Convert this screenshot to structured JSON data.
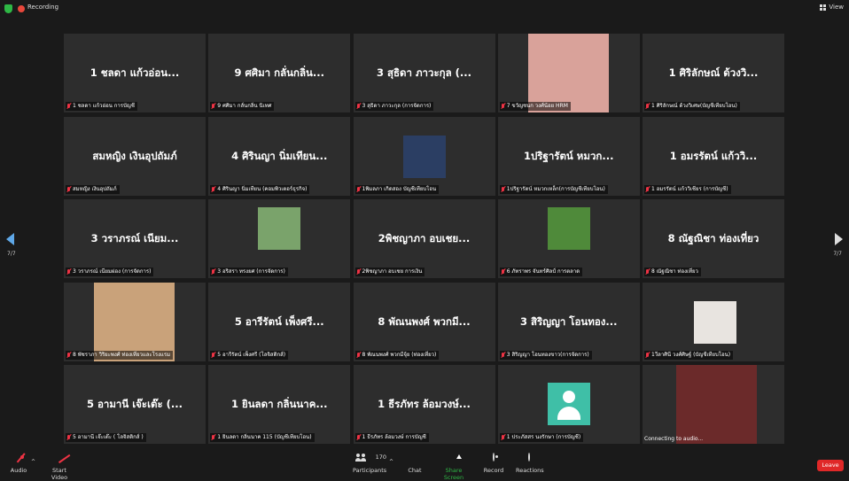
{
  "topbar": {
    "recording": "Recording",
    "view": "View"
  },
  "pages": {
    "left": "7/7",
    "right": "7/7"
  },
  "tiles": [
    {
      "name": "1 ชลดา แก้วอ่อน...",
      "label": "1 ชลดา แก้วอ่อน การบัญชี",
      "photo": false
    },
    {
      "name": "9 ศศิมา กลั่นกลิ่น...",
      "label": "9 ศศิมา กลั่นกลิ่น นิเทศ",
      "photo": false
    },
    {
      "name": "3 สุธิดา ภาวะกุล (...",
      "label": "3 สุธิดา ภาวะกุล (การจัดการ)",
      "photo": false
    },
    {
      "name": "",
      "label": "7 ขวัญชนก วงศ์น้อย HRM",
      "photo": true,
      "photo_color": "#d9a29a"
    },
    {
      "name": "1 ศิริลักษณ์ ด้วงวิ...",
      "label": "1 ศิริลักษณ์ ด้วงวิเศษ(บัญชีเทียบโอน)",
      "photo": false
    },
    {
      "name": "สมหญิง เงินอุปถัมภ์",
      "label": "สมหญิง เงินอุปถัมภ์",
      "photo": false
    },
    {
      "name": "4 ศิรินญา นิ่มเทียน...",
      "label": "4 ศิรินญา นิ่มเทียน (คอมพิวเตอร์ธุรกิจ)",
      "photo": false
    },
    {
      "name": "",
      "label": "1พิมลภา เกิดสอง บัญชีเทียบโอน",
      "photo": true,
      "photo_color": "#2b3e63"
    },
    {
      "name": "1ปริฐารัตน์ หมวก...",
      "label": "1ปริฐารัตน์ หมวกเหล็ก(การบัญชีเทียบโอน)",
      "photo": false
    },
    {
      "name": "1 อมรรัตน์ แก้ววิ...",
      "label": "1 อมรรัตน์ แก้ววิเชียร (การบัญชี)",
      "photo": false
    },
    {
      "name": "3 วราภรณ์ เนียม...",
      "label": "3 วราภรณ์ เนียมผ่อง (การจัดการ)",
      "photo": false
    },
    {
      "name": "",
      "label": "3 อริสรา ทรงยศ (การจัดการ)",
      "photo": true,
      "photo_color": "#7aa36b"
    },
    {
      "name": "2พิชญาภา อบเชย...",
      "label": "2พิชญาภา อบเชย การเงิน",
      "photo": false
    },
    {
      "name": "",
      "label": "6 ภัทราพร จันทร์ศิลป์ การตลาด",
      "photo": true,
      "photo_color": "#4f8a3a"
    },
    {
      "name": "8 ณัฐณิชา ท่องเที่ยว",
      "label": "8 ณัฐณิชา ท่องเที่ยว",
      "photo": false
    },
    {
      "name": "",
      "label": "8 พัชราภา วิริยะพงศ์ ท่องเที่ยวและโรงแรม",
      "photo": true,
      "photo_color": "#c9a27a"
    },
    {
      "name": "5 อารีรัตน์ เพ็งศรี...",
      "label": "5 อารีรัตน์ เพ็งศรี (โลจิสติกส์)",
      "photo": false
    },
    {
      "name": "8 พัณนพงศ์ พวกมี...",
      "label": "8 พัณนพงศ์ พวกมีจุ้ย (ท่องเที่ยว)",
      "photo": false
    },
    {
      "name": "3 สิริญญา โอนทอง...",
      "label": "3 สิริญญา โอนทองขาว(การจัดการ)",
      "photo": false
    },
    {
      "name": "",
      "label": "1วีลาศินี วงศ์ศิษฐ์ (บัญชีเทียบโอน)",
      "photo": true,
      "photo_color": "#e8e4e0"
    },
    {
      "name": "5 อามานี เจ๊ะเต๊ะ (...",
      "label": "5 อามานี เจ๊ะเต๊ะ ( โลจิสติกส์ )",
      "photo": false
    },
    {
      "name": "1 ยินลดา กลิ่นนาค...",
      "label": "1 ยินลดา กลิ่นนาค 115 (บัญชีเทียบโอน)",
      "photo": false
    },
    {
      "name": "1 ธีรภัทร ล้อมวงษ์...",
      "label": "1 ธีรภัทร ล้อมวงษ์ การบัญชี",
      "photo": false
    },
    {
      "name": "",
      "label": "1 ประภัสสร นงรักษา (การบัญชี)",
      "photo": "avatar"
    },
    {
      "name": "",
      "label": "",
      "status": "Connecting to audio...",
      "photo": true,
      "photo_color": "#6b2a2a"
    }
  ],
  "toolbar": {
    "audio": "Audio",
    "start_video": "Start Video",
    "participants": "Participants",
    "participants_count": "170",
    "chat": "Chat",
    "share": "Share Screen",
    "record": "Record",
    "reactions": "Reactions",
    "leave": "Leave"
  }
}
